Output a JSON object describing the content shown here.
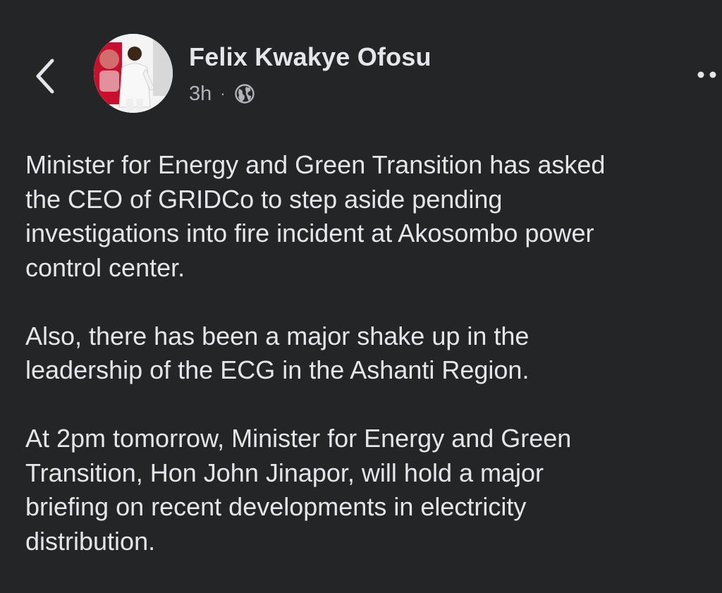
{
  "header": {
    "back_icon": "chevron-left-icon",
    "author_name": "Felix Kwakye Ofosu",
    "timestamp": "3h",
    "separator": "·",
    "privacy_icon": "globe-icon",
    "more_icon": "more-options-icon"
  },
  "post": {
    "paragraphs": [
      "Minister for Energy and Green Transition has asked\nthe CEO of GRIDCo  to step aside pending\ninvestigations into fire incident at Akosombo power\ncontrol center.",
      "Also, there has been a major shake up in the\nleadership of the ECG in the Ashanti Region.",
      "At 2pm tomorrow, Minister for Energy and Green\nTransition, Hon John Jinapor, will hold a major\nbriefing on recent developments in electricity\ndistribution."
    ]
  },
  "colors": {
    "background": "#242526",
    "primary_text": "#e4e6eb",
    "secondary_text": "#b0b3b8"
  }
}
